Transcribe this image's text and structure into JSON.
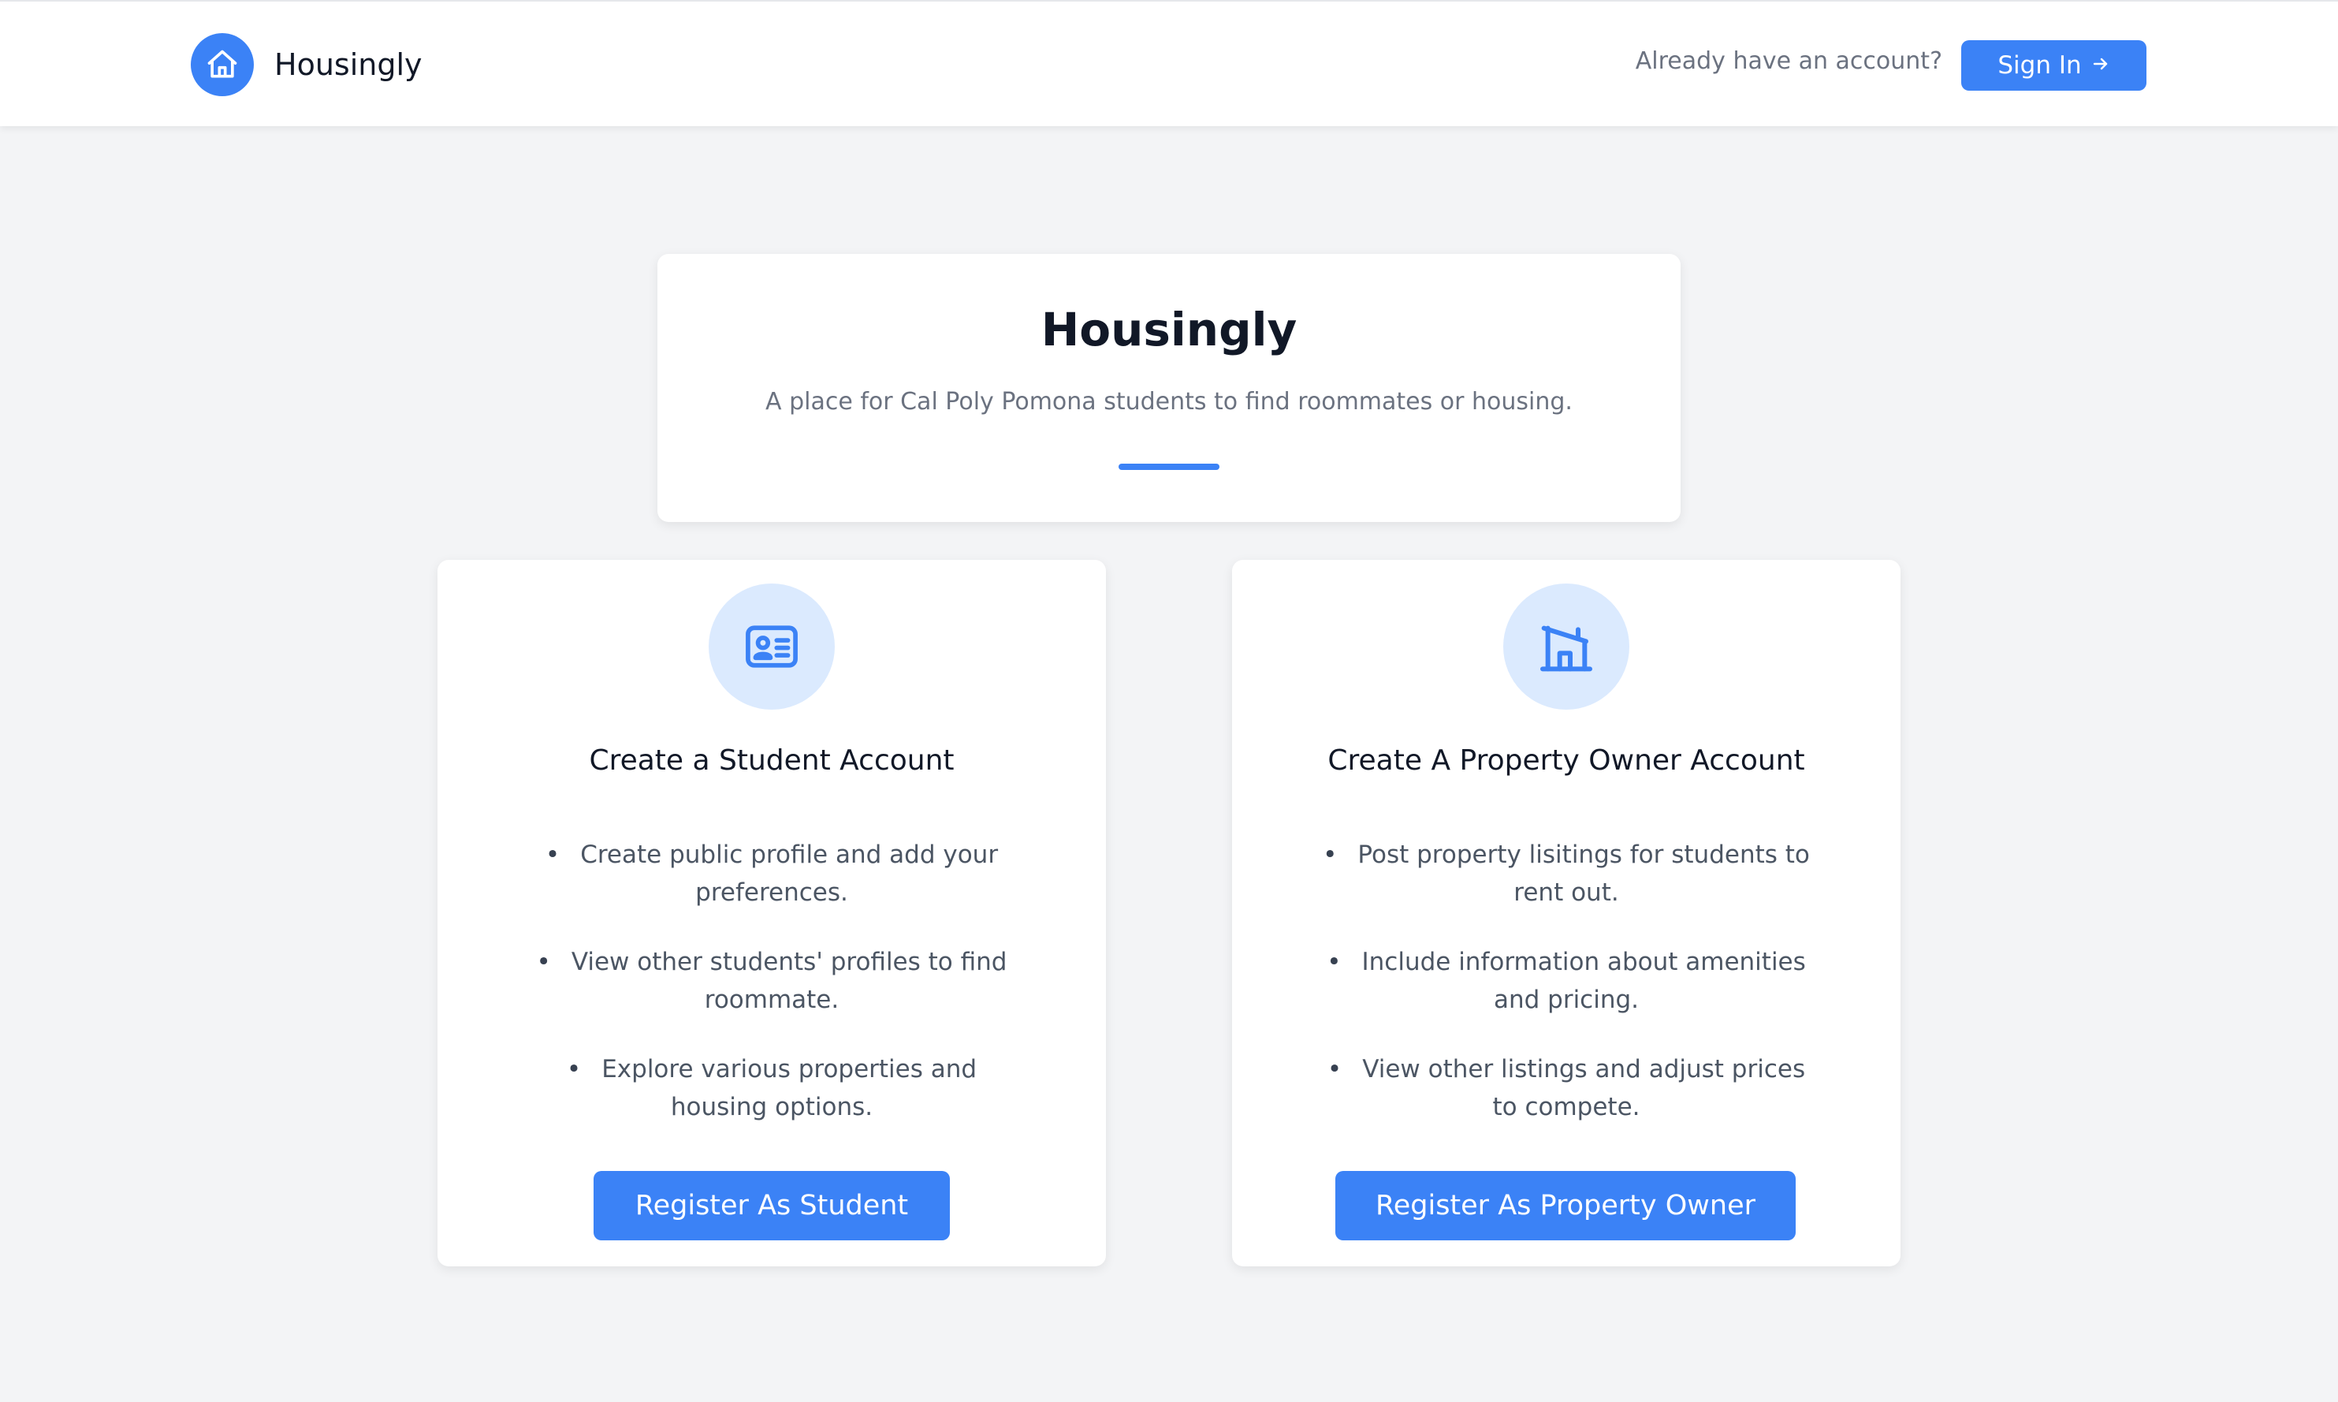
{
  "header": {
    "brand_name": "Housingly",
    "brand_icon": "house-icon",
    "account_prompt": "Already have an account?",
    "signin_label": "Sign In",
    "signin_icon": "arrow-right-icon"
  },
  "hero": {
    "title": "Housingly",
    "subtitle": "A place for Cal Poly Pomona students to find roommates or housing."
  },
  "cards": [
    {
      "icon": "id-card-icon",
      "title": "Create a Student Account",
      "features": [
        "Create public profile and add your preferences.",
        "View other students' profiles to find roommate.",
        "Explore various properties and housing options."
      ],
      "button_label": "Register As Student"
    },
    {
      "icon": "building-icon",
      "title": "Create A Property Owner Account",
      "features": [
        "Post property lisitings for students to rent out.",
        "Include information about amenities and pricing.",
        "View other listings and adjust prices to compete."
      ],
      "button_label": "Register As Property Owner"
    }
  ],
  "colors": {
    "accent": "#3b82f6",
    "accent_light": "#dbeafe",
    "background": "#f3f4f6"
  }
}
